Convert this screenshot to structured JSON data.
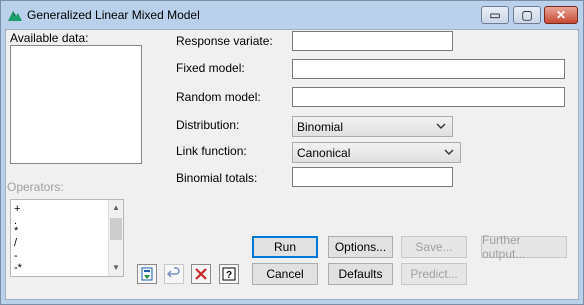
{
  "window": {
    "title": "Generalized Linear Mixed Model",
    "controls": {
      "minimize": "▭",
      "maximize": "▢",
      "close": "✕"
    }
  },
  "left": {
    "available_data_label": "Available data:",
    "operators_label": "Operators:",
    "operators": [
      "+",
      ".",
      "*",
      "/",
      "-",
      "-*"
    ]
  },
  "form": {
    "response_variate_label": "Response variate:",
    "response_variate_value": "",
    "fixed_model_label": "Fixed model:",
    "fixed_model_value": "",
    "random_model_label": "Random model:",
    "random_model_value": "",
    "distribution_label": "Distribution:",
    "distribution_value": "Binomial",
    "link_function_label": "Link function:",
    "link_function_value": "Canonical",
    "binomial_totals_label": "Binomial totals:",
    "binomial_totals_value": ""
  },
  "buttons": {
    "run": "Run",
    "options": "Options...",
    "save": "Save...",
    "further_output": "Further output...",
    "cancel": "Cancel",
    "defaults": "Defaults",
    "predict": "Predict..."
  },
  "icons": {
    "app": "genstat-logo-icon",
    "transfer": "transfer-icon",
    "undo": "undo-arrow-icon",
    "clear": "red-x-icon",
    "help": "help-question-icon",
    "dropdown": "chevron-down-icon"
  },
  "colors": {
    "accent": "#0078d7",
    "close_button": "#c64a32",
    "disabled_text": "#a0a0a0"
  }
}
